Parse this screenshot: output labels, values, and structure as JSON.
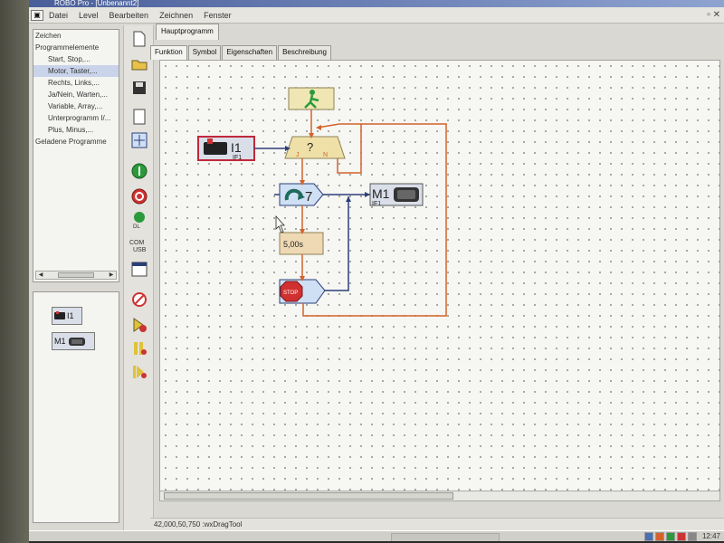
{
  "window": {
    "title": "ROBO Pro - [Unbenannt2]"
  },
  "menu": [
    "Datei",
    "Level",
    "Bearbeiten",
    "Zeichnen",
    "Fenster"
  ],
  "tree": [
    {
      "label": "Zeichen",
      "level": 1
    },
    {
      "label": "Programmelemente",
      "level": 1
    },
    {
      "label": "Start, Stop,...",
      "level": 2
    },
    {
      "label": "Motor, Taster,...",
      "level": 2,
      "selected": true
    },
    {
      "label": "Rechts, Links,...",
      "level": 2
    },
    {
      "label": "Ja/Nein, Warten,...",
      "level": 2
    },
    {
      "label": "Variable, Array,...",
      "level": 2
    },
    {
      "label": "Unterprogramm I/...",
      "level": 2
    },
    {
      "label": "Plus, Minus,...",
      "level": 2
    },
    {
      "label": "Geladene Programme",
      "level": 1
    }
  ],
  "preview": {
    "input": {
      "label": "I1",
      "sub": "IF1"
    },
    "motor": {
      "label": "M1",
      "sub": "IF1"
    }
  },
  "tabs": [
    "Hauptprogramm"
  ],
  "subtabs": [
    "Funktion",
    "Symbol",
    "Eigenschaften",
    "Beschreibung"
  ],
  "flow": {
    "input_label": "I1",
    "input_sub": "IF1",
    "branch_label": "?",
    "branch_yes": "J",
    "branch_no": "N",
    "counter": "7",
    "motor_label": "M1",
    "motor_sub": "IF1",
    "wait": "5,00s",
    "stop_text": "STOP"
  },
  "status": "42,000,50,750 :wxDragTool",
  "clock": "12:47",
  "colors": {
    "flow": "#d4622a",
    "data": "#2b3f77",
    "accent": "#c0283a"
  }
}
